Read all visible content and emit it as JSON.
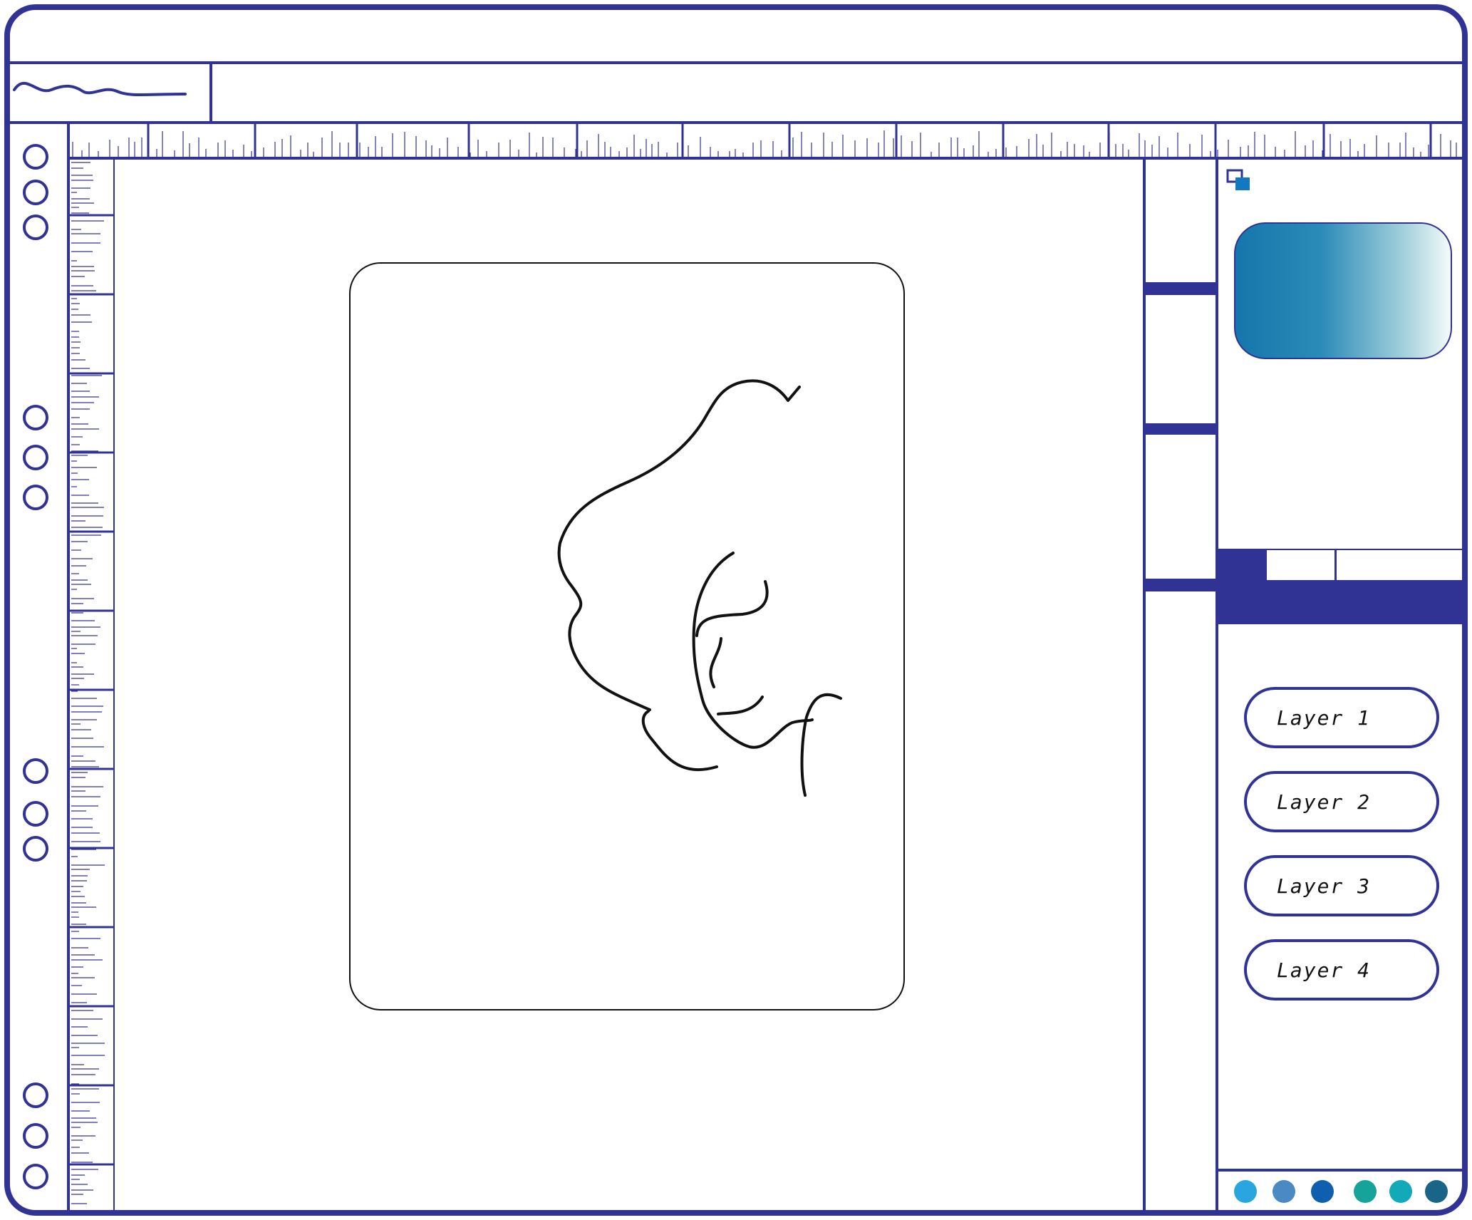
{
  "layers": {
    "items": [
      {
        "label": "Layer 1"
      },
      {
        "label": "Layer 2"
      },
      {
        "label": "Layer 3"
      },
      {
        "label": "Layer 4"
      }
    ]
  },
  "colors": {
    "accent": "#313394",
    "gradient_start": "#1576ab",
    "gradient_end": "#f4fbfa",
    "swatches": [
      "#29a6e0",
      "#4a89c4",
      "#0e5fae",
      "#15a39a",
      "#12a9b8",
      "#1a6585"
    ]
  },
  "icons": {
    "logo": "wave-logo-icon",
    "color_mode": "fill-stroke-icon"
  }
}
